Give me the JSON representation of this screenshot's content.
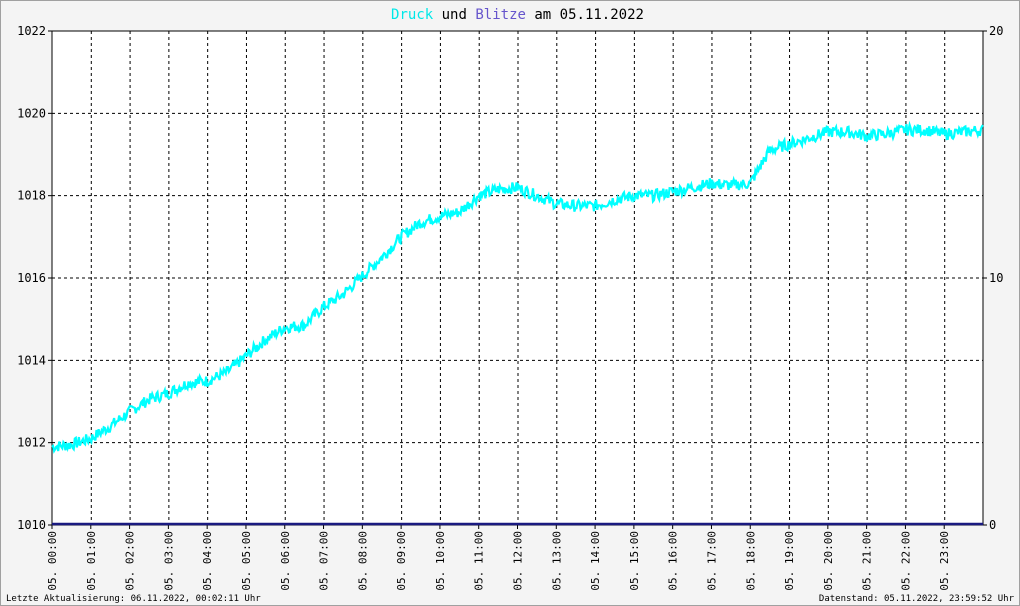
{
  "chart_data": {
    "type": "line",
    "title": {
      "part1": "Druck",
      "part2": " und ",
      "part3": "Blitze",
      "part4": " am 05.11.2022"
    },
    "title_colors": {
      "druck": "#00e8e8",
      "blitze": "#6655cc",
      "text": "#000000"
    },
    "y_left": {
      "min": 1010,
      "max": 1022,
      "ticks": [
        1010,
        1012,
        1014,
        1016,
        1018,
        1020,
        1022
      ]
    },
    "y_right": {
      "min": 0,
      "max": 20,
      "ticks": [
        0,
        10,
        20
      ]
    },
    "x_ticks": [
      "05. 00:00",
      "05. 01:00",
      "05. 02:00",
      "05. 03:00",
      "05. 04:00",
      "05. 05:00",
      "05. 06:00",
      "05. 07:00",
      "05. 08:00",
      "05. 09:00",
      "05. 10:00",
      "05. 11:00",
      "05. 12:00",
      "05. 13:00",
      "05. 14:00",
      "05. 15:00",
      "05. 16:00",
      "05. 17:00",
      "05. 18:00",
      "05. 19:00",
      "05. 20:00",
      "05. 21:00",
      "05. 22:00",
      "05. 23:00"
    ],
    "grid": true,
    "series": [
      {
        "color": "#00ffff",
        "axis": "left",
        "hours": [
          0,
          0.5,
          1,
          1.5,
          2,
          2.5,
          3,
          3.5,
          4,
          4.5,
          5,
          5.5,
          6,
          6.5,
          7,
          7.5,
          8,
          8.5,
          9,
          9.5,
          10,
          10.5,
          11,
          11.5,
          12,
          12.5,
          13,
          13.5,
          14,
          14.5,
          15,
          15.5,
          16,
          16.5,
          17,
          17.5,
          18,
          18.25,
          18.5,
          19,
          19.5,
          20,
          20.5,
          21,
          21.5,
          22,
          22.5,
          23,
          23.5,
          24
        ],
        "values": [
          1011.9,
          1011.95,
          1012.1,
          1012.4,
          1012.75,
          1013.05,
          1013.2,
          1013.45,
          1013.5,
          1013.7,
          1014.1,
          1014.5,
          1014.8,
          1014.85,
          1015.3,
          1015.6,
          1016.05,
          1016.5,
          1017.0,
          1017.35,
          1017.5,
          1017.6,
          1018.0,
          1018.15,
          1018.2,
          1018.0,
          1017.8,
          1017.75,
          1017.75,
          1017.9,
          1018.0,
          1018.0,
          1018.1,
          1018.2,
          1018.3,
          1018.25,
          1018.3,
          1018.7,
          1019.1,
          1019.25,
          1019.4,
          1019.55,
          1019.55,
          1019.45,
          1019.5,
          1019.6,
          1019.6,
          1019.5,
          1019.55,
          1019.6
        ]
      },
      {
        "color": "#1a1a80",
        "axis": "right",
        "hours": [
          0,
          24
        ],
        "values": [
          0,
          0
        ]
      }
    ]
  },
  "footer": {
    "left": "Letzte Aktualisierung: 06.11.2022, 00:02:11 Uhr",
    "right": "Datenstand: 05.11.2022, 23:59:52 Uhr"
  }
}
